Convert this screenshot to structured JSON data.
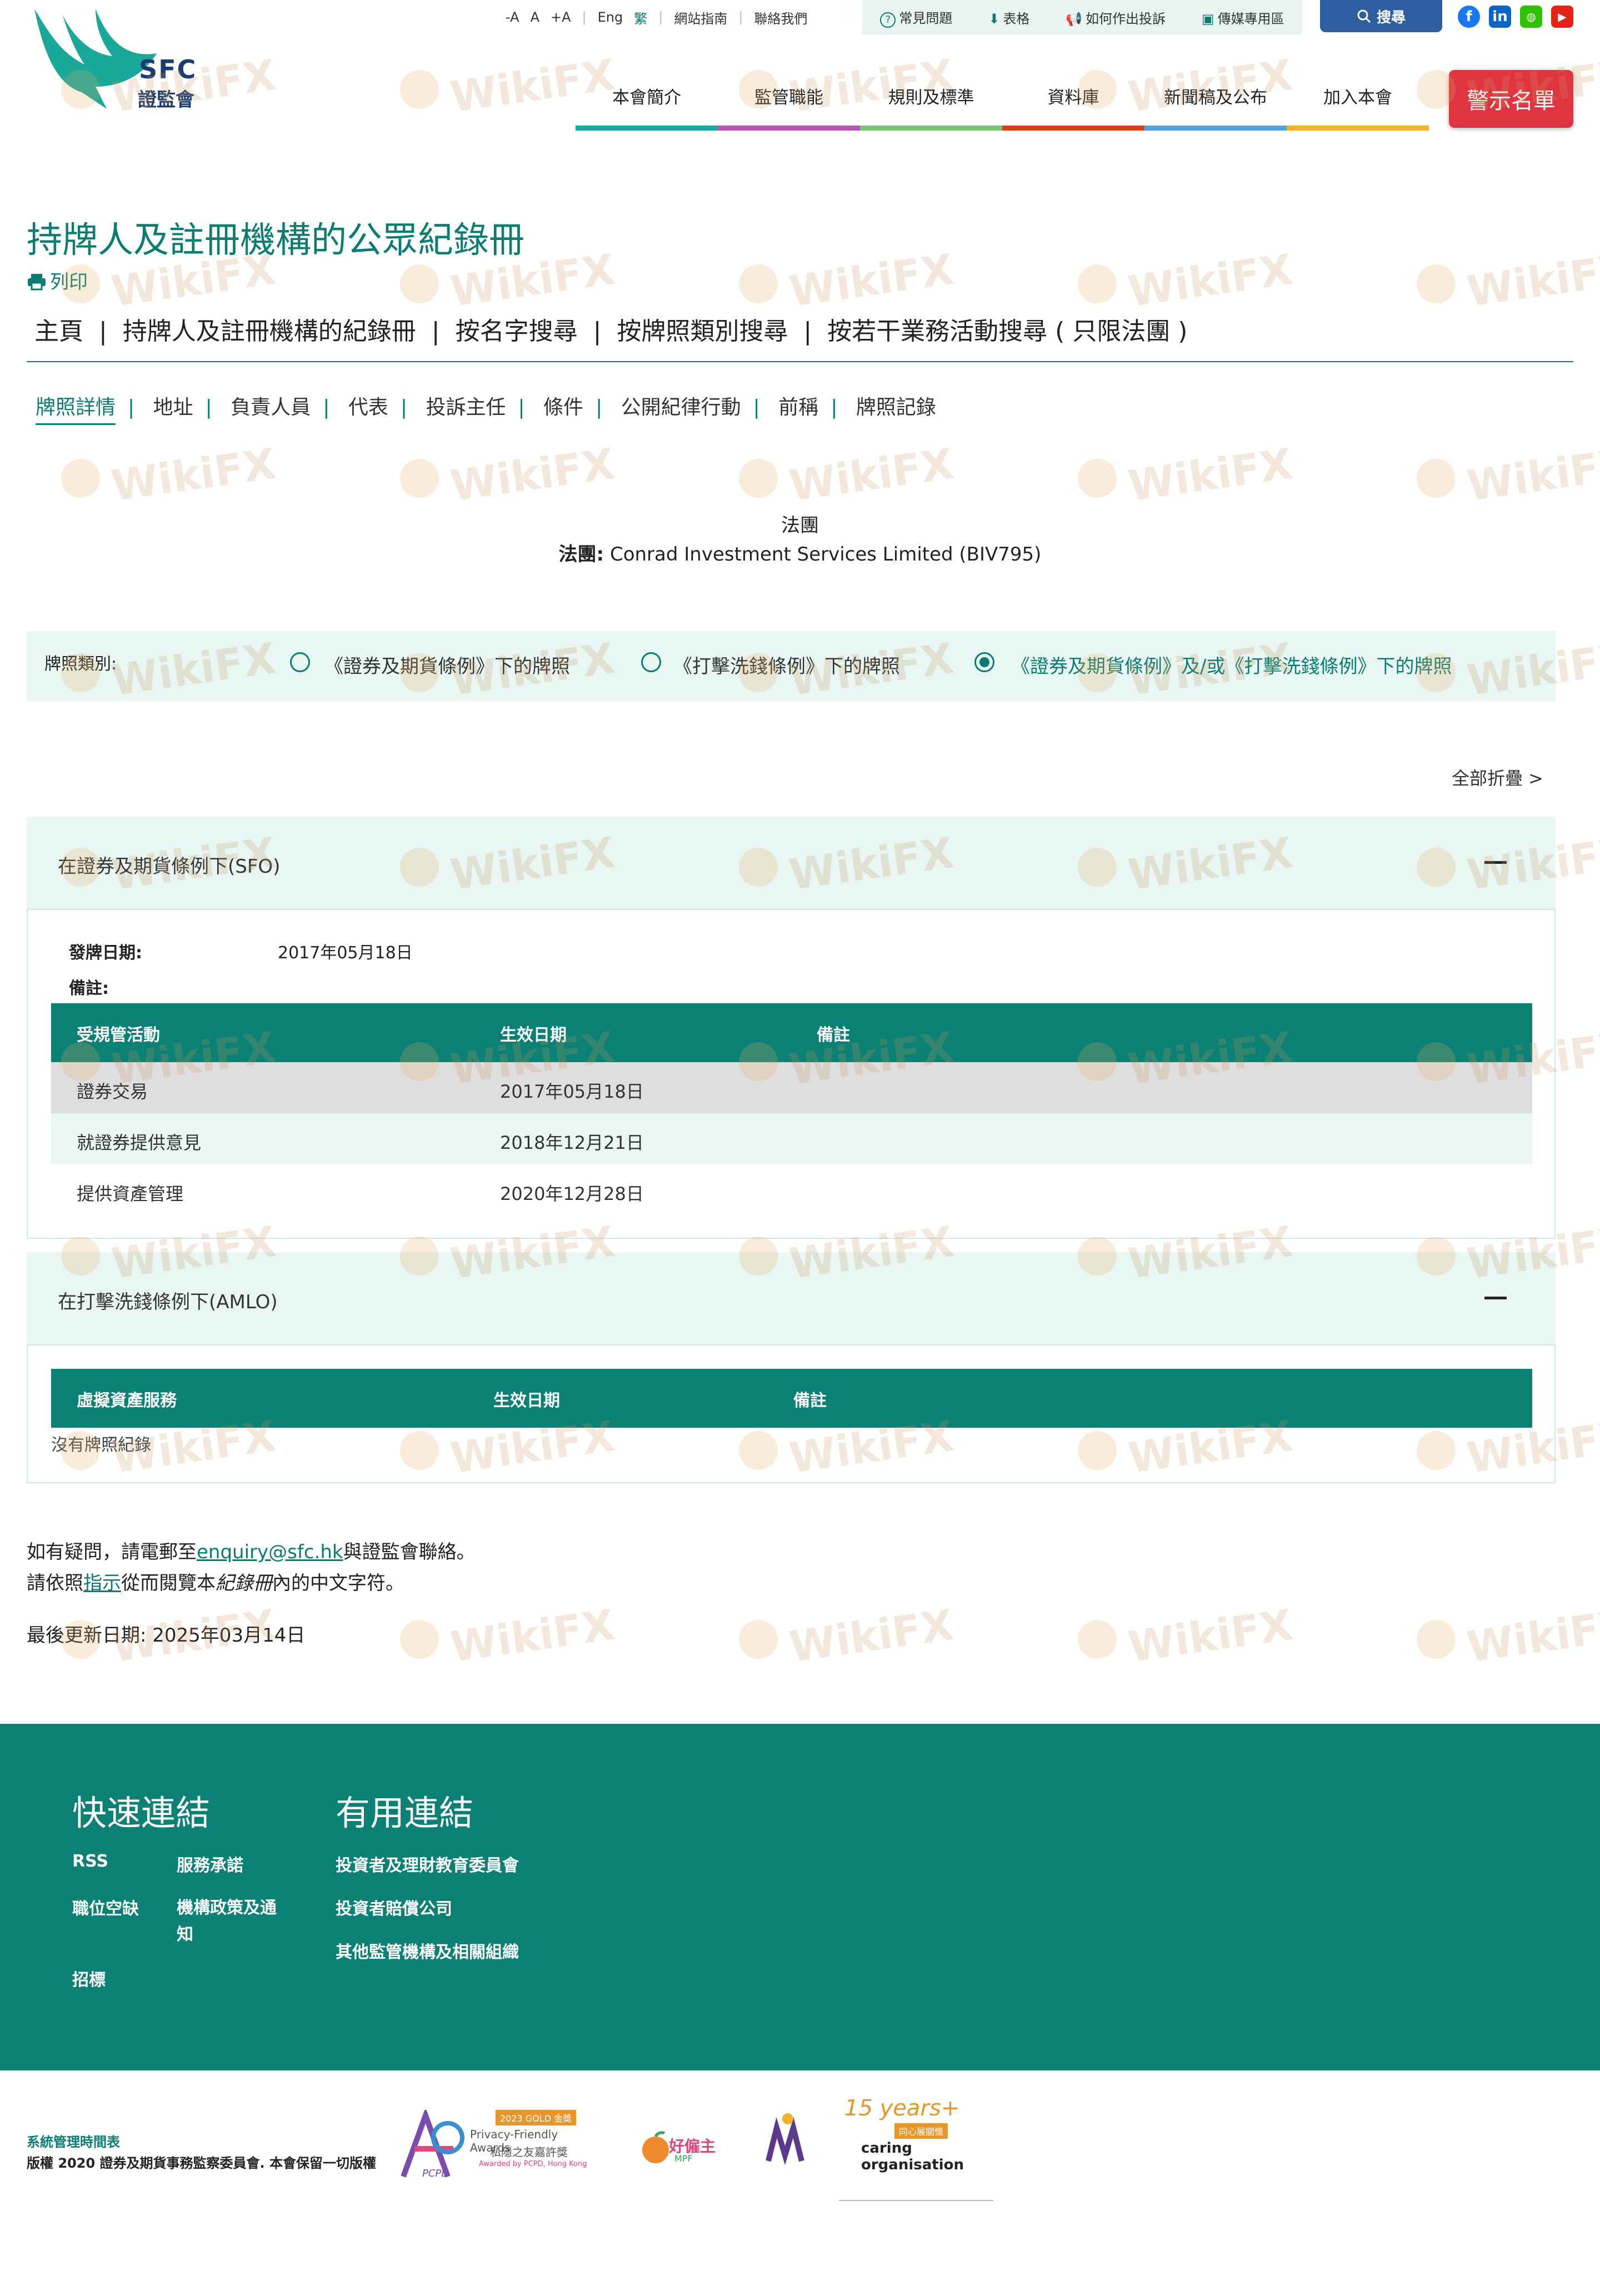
{
  "header": {
    "logo_mark": "SFC",
    "logo_text": "證監會",
    "font_sizes": [
      "-A",
      "A",
      "+A"
    ],
    "lang": [
      "Eng",
      "繁"
    ],
    "util_links": [
      "網站指南",
      "聯絡我們"
    ],
    "util_box": [
      "常見問題",
      "表格",
      "如何作出投訴",
      "傳媒專用區"
    ],
    "search_label": "搜尋",
    "nav": [
      "本會簡介",
      "監管職能",
      "規則及標準",
      "資料庫",
      "新聞稿及公布",
      "加入本會"
    ],
    "nav_colors": [
      "#1aa89a",
      "#b455b3",
      "#7cc576",
      "#d9411e",
      "#5aa0d8",
      "#f1b22f"
    ],
    "warning_label": "警示名單"
  },
  "page": {
    "title": "持牌人及註冊機構的公眾紀錄冊",
    "print_label": "列印",
    "breadcrumbs": [
      "主頁",
      "持牌人及註冊機構的紀錄冊",
      "按名字搜尋",
      "按牌照類別搜尋",
      "按若干業務活動搜尋 ( 只限法團 )"
    ],
    "tabs": [
      "牌照詳情",
      "地址",
      "負責人員",
      "代表",
      "投訴主任",
      "條件",
      "公開紀律行動",
      "前稱",
      "牌照記錄"
    ],
    "entity_type": "法團",
    "entity_label": "法團:",
    "entity_name": "Conrad Investment Services Limited (BIV795)",
    "license_type_label": "牌照類別:",
    "license_options": [
      "《證券及期貨條例》下的牌照",
      "《打擊洗錢條例》下的牌照",
      "《證券及期貨條例》及/或《打擊洗錢條例》下的牌照"
    ],
    "selected_option": 2,
    "collapse_all": "全部折疊 >"
  },
  "sfo": {
    "title": "在證券及期貨條例下(SFO)",
    "issue_label": "發牌日期:",
    "issue_date": "2017年05月18日",
    "remark_label": "備註:",
    "columns": [
      "受規管活動",
      "生效日期",
      "備註"
    ],
    "rows": [
      {
        "activity": "證券交易",
        "date": "2017年05月18日",
        "remark": ""
      },
      {
        "activity": "就證券提供意見",
        "date": "2018年12月21日",
        "remark": ""
      },
      {
        "activity": "提供資產管理",
        "date": "2020年12月28日",
        "remark": ""
      }
    ]
  },
  "amlo": {
    "title": "在打擊洗錢條例下(AMLO)",
    "columns": [
      "虛擬資產服務",
      "生效日期",
      "備註"
    ],
    "empty_text": "沒有牌照紀錄"
  },
  "notes": {
    "enquiry_prefix": "如有疑問，請電郵至",
    "enquiry_email": "enquiry@sfc.hk",
    "enquiry_suffix": "與證監會聯絡。",
    "guide_prefix": "請依照",
    "guide_link": "指示",
    "guide_mid": "從而閱覽本",
    "guide_em": "紀錄冊",
    "guide_suffix": "內的中文字符。",
    "updated_label": "最後更新日期:",
    "updated_date": "2025年03月14日"
  },
  "footer": {
    "quick_title": "快速連結",
    "quick_links": [
      "RSS",
      "服務承諾",
      "職位空缺",
      "機構政策及通知",
      "招標"
    ],
    "useful_title": "有用連結",
    "useful_links": [
      "投資者及理財教育委員會",
      "投資者賠償公司",
      "其他監管機構及相關組織"
    ],
    "schedule": "系統管理時間表",
    "copyright": "版權 2020 證券及期貨事務監察委員會. 本會保留一切版權",
    "awards": [
      "PCPD",
      "2023 GOLD 金獎",
      "Privacy-Friendly Awards",
      "私隱之友嘉許獎",
      "Awarded by PCPD, Hong Kong",
      "好僱主",
      "MPF",
      "15 years+",
      "同心展關懷",
      "caring organisation"
    ]
  },
  "watermark": "WikiFX"
}
